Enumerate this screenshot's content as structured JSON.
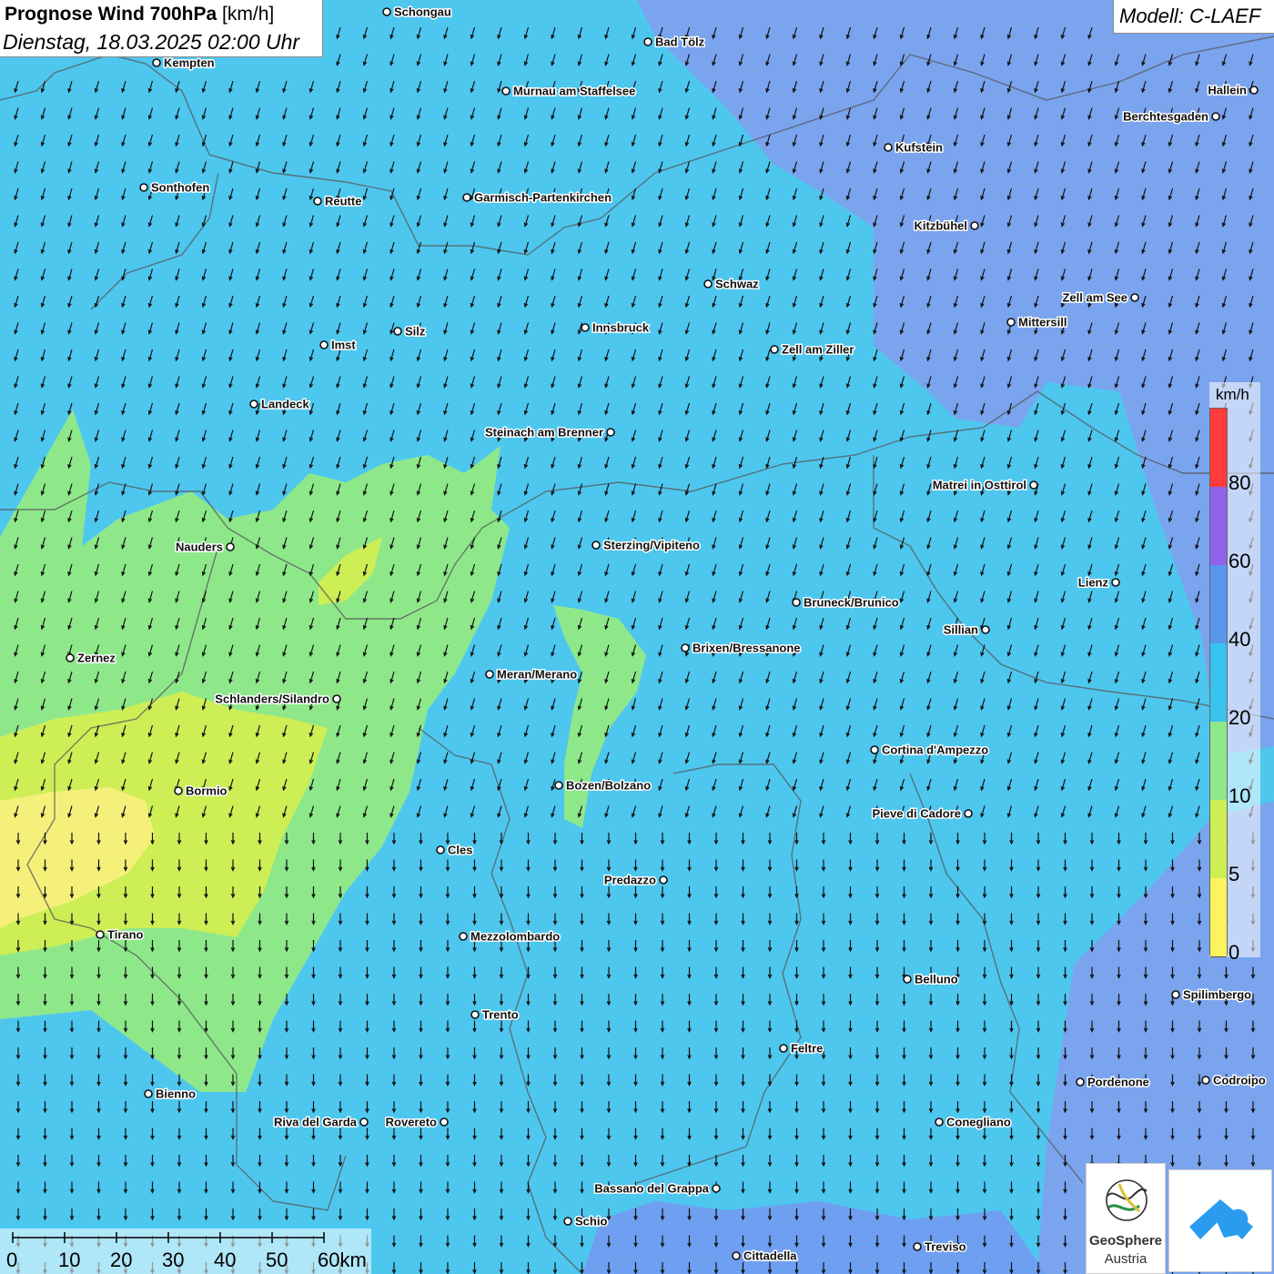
{
  "title": {
    "main": "Prognose Wind 700hPa",
    "unit": "[km/h]",
    "date": "Dienstag, 18.03.2025 02:00 Uhr"
  },
  "model": "Modell: C-LAEF",
  "legend": {
    "unit": "km/h",
    "labels": [
      "80",
      "60",
      "40",
      "20",
      "10",
      "5",
      "0"
    ],
    "colors": [
      "#ff3b3b",
      "#8f62ea",
      "#5a97ec",
      "#39c2ee",
      "#8ee88a",
      "#cdee55",
      "#fcf35e"
    ]
  },
  "scalebar": {
    "labels": [
      "0",
      "10",
      "20",
      "30",
      "40",
      "50",
      "60km"
    ]
  },
  "map": {
    "wind_direction": "from north-northeast",
    "cities": [
      {
        "name": "Schongau"
      },
      {
        "name": "Bad Tölz"
      },
      {
        "name": "Kempten"
      },
      {
        "name": "Murnau am Staffelsee"
      },
      {
        "name": "Hallein"
      },
      {
        "name": "Berchtesgaden"
      },
      {
        "name": "Kufstein"
      },
      {
        "name": "Sonthofen"
      },
      {
        "name": "Reutte"
      },
      {
        "name": "Garmisch-Partenkirchen"
      },
      {
        "name": "Kitzbühel"
      },
      {
        "name": "Schwaz"
      },
      {
        "name": "Zell am See"
      },
      {
        "name": "Mittersill"
      },
      {
        "name": "Innsbruck"
      },
      {
        "name": "Silz"
      },
      {
        "name": "Imst"
      },
      {
        "name": "Zell am Ziller"
      },
      {
        "name": "Landeck"
      },
      {
        "name": "Steinach am Brenner"
      },
      {
        "name": "Matrei in Osttirol"
      },
      {
        "name": "Nauders"
      },
      {
        "name": "Sterzing/Vipiteno"
      },
      {
        "name": "Lienz"
      },
      {
        "name": "Bruneck/Brunico"
      },
      {
        "name": "Sillian"
      },
      {
        "name": "Brixen/Bressanone"
      },
      {
        "name": "Zernez"
      },
      {
        "name": "Meran/Merano"
      },
      {
        "name": "Schlanders/Silandro"
      },
      {
        "name": "Cortina d'Ampezzo"
      },
      {
        "name": "Bozen/Bolzano"
      },
      {
        "name": "Bormio"
      },
      {
        "name": "Pieve di Cadore"
      },
      {
        "name": "Cles"
      },
      {
        "name": "Predazzo"
      },
      {
        "name": "Tirano"
      },
      {
        "name": "Mezzolombardo"
      },
      {
        "name": "Belluno"
      },
      {
        "name": "Spilimbergo"
      },
      {
        "name": "Trento"
      },
      {
        "name": "Feltre"
      },
      {
        "name": "Bienno"
      },
      {
        "name": "Pordenone"
      },
      {
        "name": "Codroipo"
      },
      {
        "name": "Riva del Garda"
      },
      {
        "name": "Rovereto"
      },
      {
        "name": "Conegliano"
      },
      {
        "name": "Bassano del Grappa"
      },
      {
        "name": "Schio"
      },
      {
        "name": "Treviso"
      },
      {
        "name": "Cittadella"
      }
    ]
  },
  "logo": {
    "line1": "GeoSphere",
    "line2": "Austria"
  },
  "colors": {
    "wind_0_5": "#fcf35e",
    "wind_5_10": "#cdee55",
    "wind_10_20": "#8ee88a",
    "wind_20_40": "#4cc7f0",
    "wind_40_60": "#6f9ff0"
  }
}
